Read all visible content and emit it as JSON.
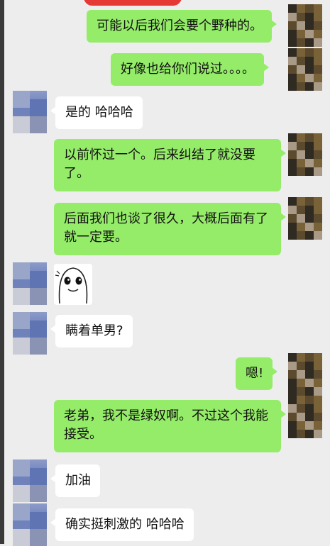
{
  "chat": {
    "messages": [
      {
        "side": "out",
        "text": "可能以后我们会要个野种的。"
      },
      {
        "side": "out",
        "text": "好像也给你们说过。。。。"
      },
      {
        "side": "in",
        "text": "是的 哈哈哈"
      },
      {
        "side": "out",
        "text": "以前怀过一个。后来纠结了就没要了。"
      },
      {
        "side": "out",
        "text": "后面我们也谈了很久，大概后面有了就一定要。"
      },
      {
        "side": "in",
        "sticker": "smiling-face-sticker"
      },
      {
        "side": "in",
        "text": "瞒着单男?"
      },
      {
        "side": "out",
        "text": "嗯!"
      },
      {
        "side": "out",
        "text": "老弟，我不是绿奴啊。不过这个我能接受。"
      },
      {
        "side": "in",
        "text": "加油"
      },
      {
        "side": "in",
        "text": "确实挺刺激的 哈哈哈"
      }
    ]
  },
  "colors": {
    "background": "#ededed",
    "outgoing_bubble": "#95ec69",
    "incoming_bubble": "#ffffff"
  }
}
